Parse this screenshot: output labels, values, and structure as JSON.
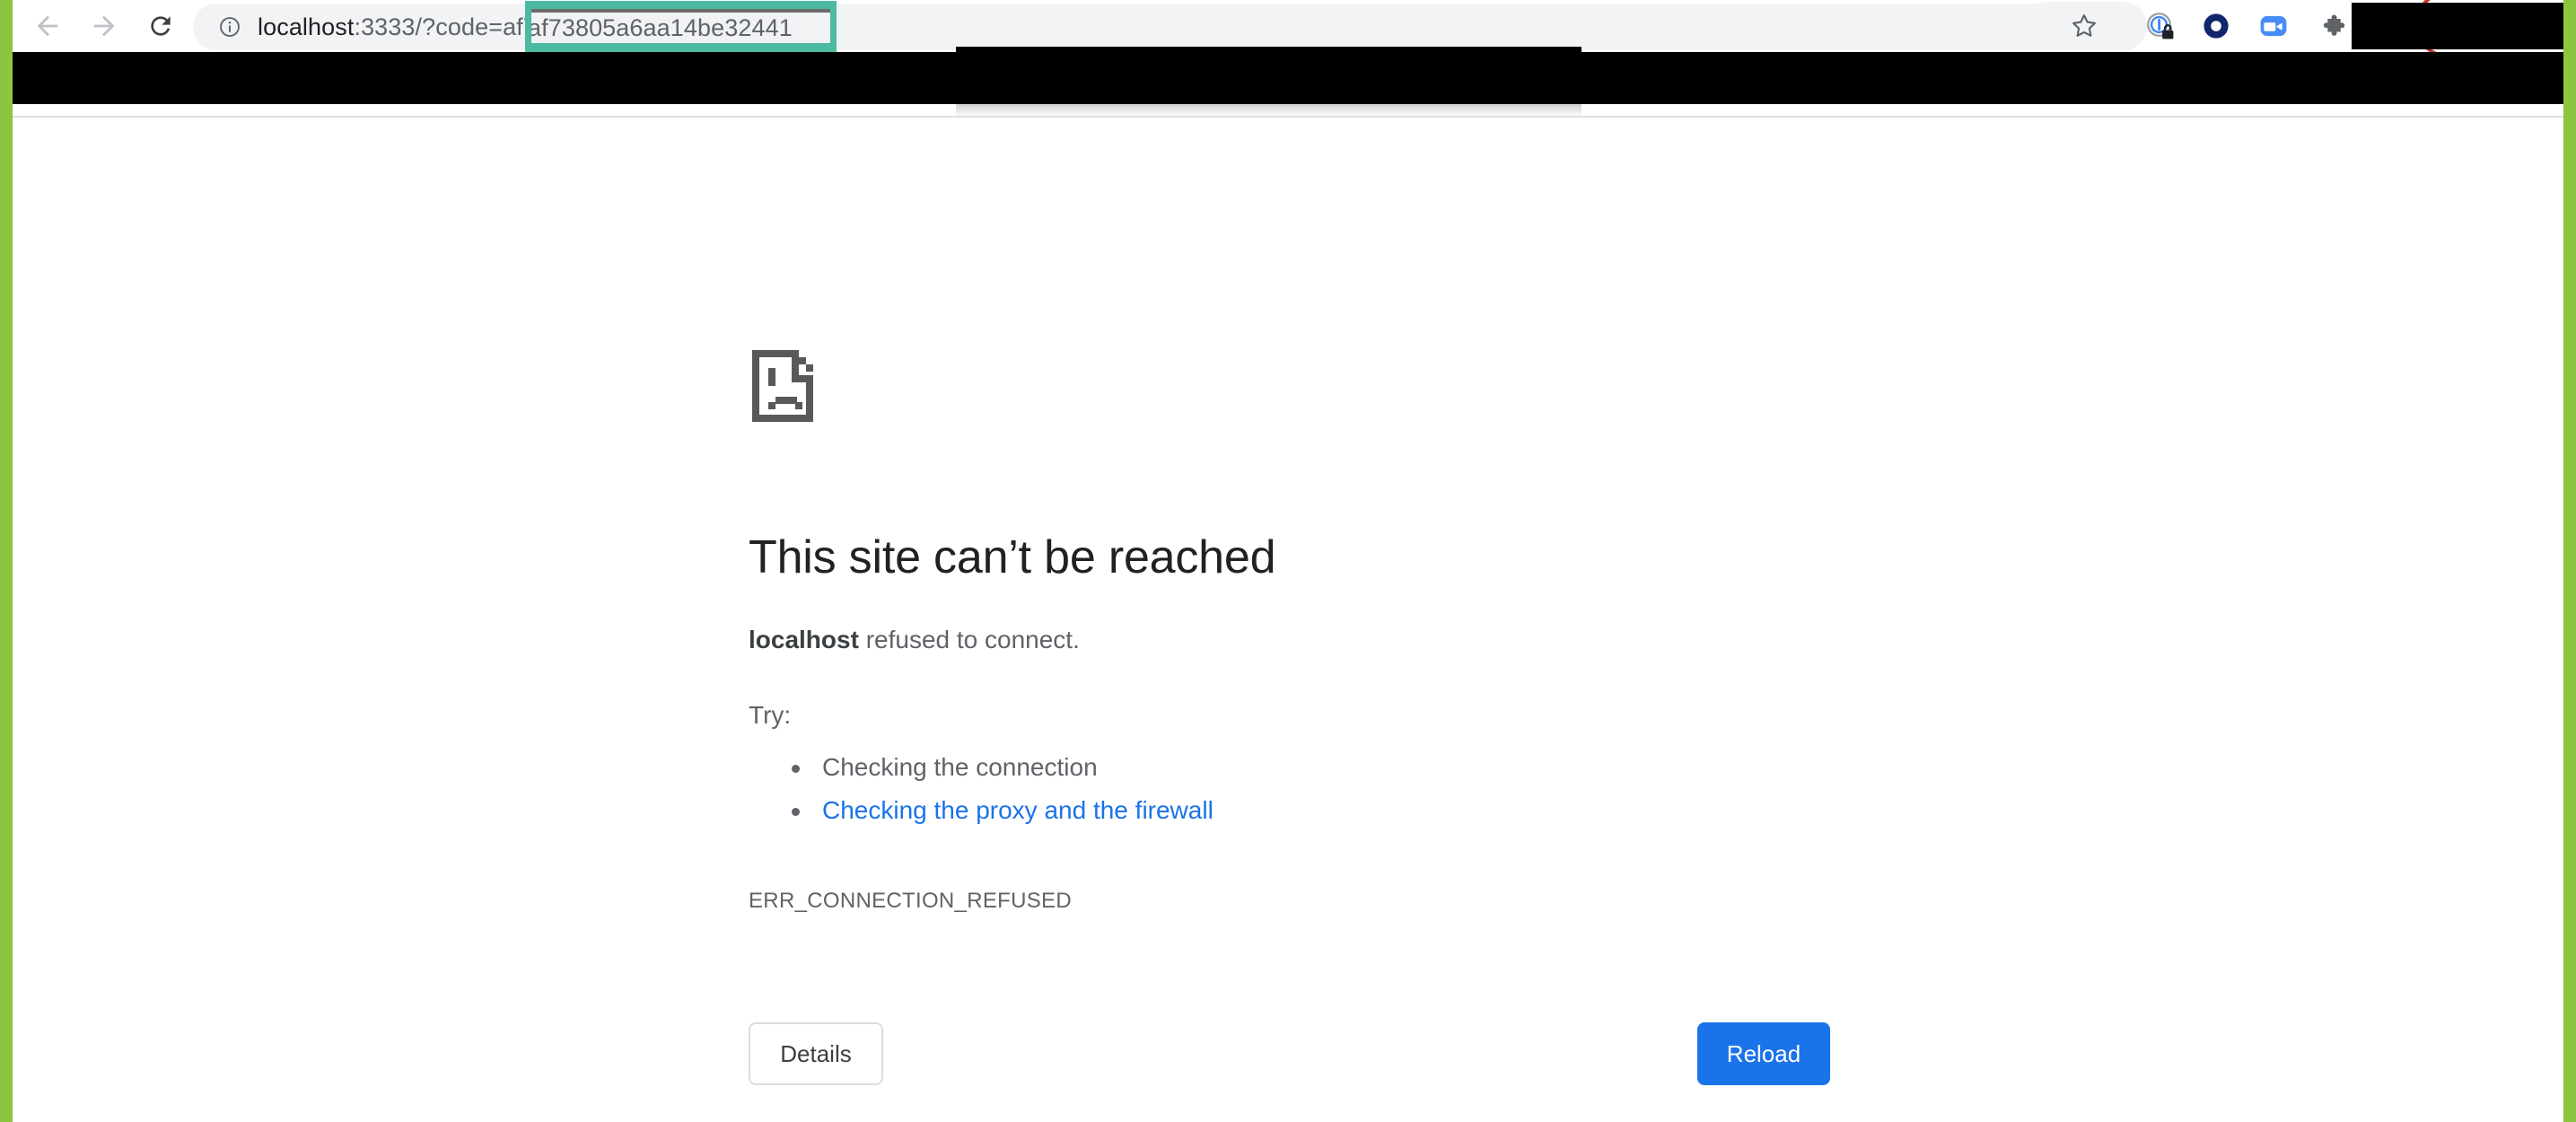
{
  "browser": {
    "nav": {
      "back_label": "Back",
      "forward_label": "Forward",
      "reload_label": "Reload this page"
    },
    "omnibox": {
      "site_info_label": "View site information",
      "url_host": "localhost",
      "url_port_path": ":3333/?code=",
      "url_code_value": "af73805a6aa14be32441",
      "full_url": "localhost:3333/?code=af73805a6aa14be32441"
    },
    "toolbar_icons": [
      {
        "name": "bookmark-star-icon",
        "label": "Bookmark this tab"
      },
      {
        "name": "password-manager-icon",
        "label": "1Password"
      },
      {
        "name": "ring-extension-icon",
        "label": "Extension"
      },
      {
        "name": "zoom-video-icon",
        "label": "Zoom"
      },
      {
        "name": "extensions-puzzle-icon",
        "label": "Extensions"
      }
    ],
    "redacted_profile_label": "",
    "annotations": {
      "code_highlight_color": "#4cb9a2",
      "profile_highlight_color": "#c0392b",
      "edge_strip_color": "#8cc63e"
    }
  },
  "error_page": {
    "icon_name": "sad-page-icon",
    "headline": "This site can’t be reached",
    "sub_host": "localhost",
    "sub_rest": " refused to connect.",
    "try_label": "Try:",
    "suggestions": [
      {
        "text": "Checking the connection",
        "is_link": false
      },
      {
        "text": "Checking the proxy and the firewall",
        "is_link": true
      }
    ],
    "error_code": "ERR_CONNECTION_REFUSED",
    "buttons": {
      "details": "Details",
      "reload": "Reload"
    },
    "colors": {
      "link": "#1a73e8",
      "primary_button": "#1a73e8",
      "text": "#5f6368",
      "headline": "#202124"
    }
  }
}
